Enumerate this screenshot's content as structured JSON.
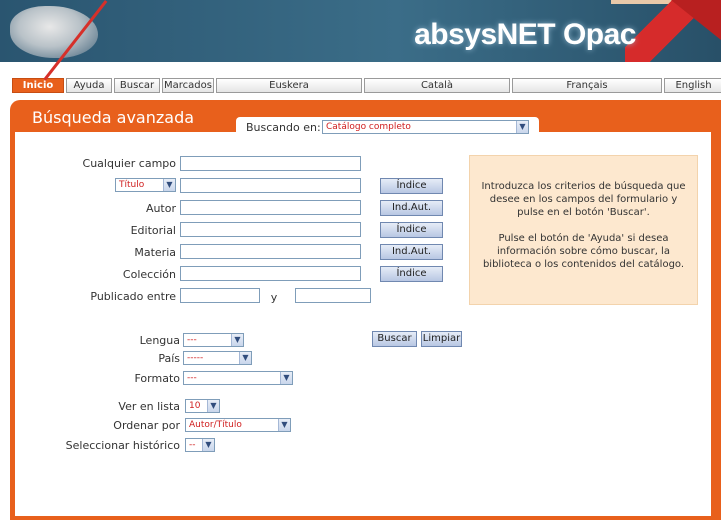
{
  "banner": {
    "title": "absysNET Opac"
  },
  "nav": {
    "items": [
      "Inicio",
      "Ayuda",
      "Buscar",
      "Marcados",
      "Euskera",
      "Català",
      "Français",
      "English"
    ]
  },
  "panel": {
    "title": "Búsqueda avanzada",
    "buscando_label": "Buscando en:",
    "buscando_value": "Catálogo completo"
  },
  "form": {
    "cualquier_campo": "Cualquier campo",
    "titulo_select": "Título",
    "autor": "Autor",
    "editorial": "Editorial",
    "materia": "Materia",
    "coleccion": "Colección",
    "publicado_entre": "Publicado entre",
    "y": "y",
    "lengua": "Lengua",
    "lengua_value": "---",
    "pais": "País",
    "pais_value": "-----",
    "formato": "Formato",
    "formato_value": "---",
    "ver_en_lista": "Ver en lista",
    "ver_en_lista_value": "10",
    "ordenar_por": "Ordenar por",
    "ordenar_por_value": "Autor/Título",
    "seleccionar_historico": "Seleccionar histórico",
    "seleccionar_historico_value": "--"
  },
  "buttons": {
    "indice": "Índice",
    "ind_aut": "Ind.Aut.",
    "buscar": "Buscar",
    "limpiar": "Limpiar"
  },
  "info": {
    "p1": "Introduzca los criterios de búsqueda que desee en los campos del formulario y pulse en el botón 'Buscar'.",
    "p2": "Pulse el botón de 'Ayuda' si desea información sobre cómo buscar, la biblioteca o los contenidos del catálogo."
  },
  "colors": {
    "accent": "#e8601c",
    "banner": "#2d5a72",
    "info_bg": "#fde8cf"
  }
}
